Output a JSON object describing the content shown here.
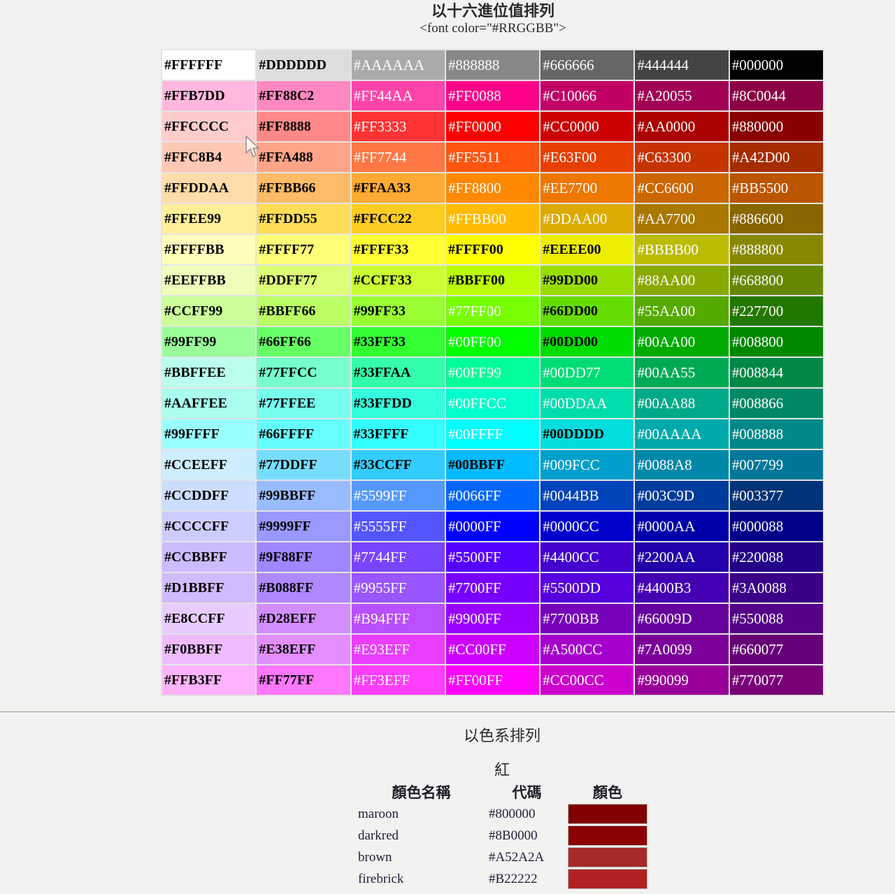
{
  "page": {
    "title": "以十六進位值排列",
    "subtitle": "<font color=\"#RRGGBB\">"
  },
  "colors": {
    "page_background": "#f2f2f0",
    "dark_text": "#000000",
    "light_text": "#FFFFFF"
  },
  "hex_table": {
    "rows": [
      [
        {
          "code": "#FFFFFF",
          "fg": "#000000"
        },
        {
          "code": "#DDDDDD",
          "fg": "#000000"
        },
        {
          "code": "#AAAAAA",
          "fg": "#FFFFFF"
        },
        {
          "code": "#888888",
          "fg": "#FFFFFF"
        },
        {
          "code": "#666666",
          "fg": "#FFFFFF"
        },
        {
          "code": "#444444",
          "fg": "#FFFFFF"
        },
        {
          "code": "#000000",
          "fg": "#FFFFFF"
        }
      ],
      [
        {
          "code": "#FFB7DD",
          "fg": "#000000"
        },
        {
          "code": "#FF88C2",
          "fg": "#000000"
        },
        {
          "code": "#FF44AA",
          "fg": "#FFFFFF"
        },
        {
          "code": "#FF0088",
          "fg": "#FFFFFF"
        },
        {
          "code": "#C10066",
          "fg": "#FFFFFF"
        },
        {
          "code": "#A20055",
          "fg": "#FFFFFF"
        },
        {
          "code": "#8C0044",
          "fg": "#FFFFFF"
        }
      ],
      [
        {
          "code": "#FFCCCC",
          "fg": "#000000"
        },
        {
          "code": "#FF8888",
          "fg": "#000000"
        },
        {
          "code": "#FF3333",
          "fg": "#FFFFFF"
        },
        {
          "code": "#FF0000",
          "fg": "#FFFFFF"
        },
        {
          "code": "#CC0000",
          "fg": "#FFFFFF"
        },
        {
          "code": "#AA0000",
          "fg": "#FFFFFF"
        },
        {
          "code": "#880000",
          "fg": "#FFFFFF"
        }
      ],
      [
        {
          "code": "#FFC8B4",
          "fg": "#000000"
        },
        {
          "code": "#FFA488",
          "fg": "#000000"
        },
        {
          "code": "#FF7744",
          "fg": "#FFFFFF"
        },
        {
          "code": "#FF5511",
          "fg": "#FFFFFF"
        },
        {
          "code": "#E63F00",
          "fg": "#FFFFFF"
        },
        {
          "code": "#C63300",
          "fg": "#FFFFFF"
        },
        {
          "code": "#A42D00",
          "fg": "#FFFFFF"
        }
      ],
      [
        {
          "code": "#FFDDAA",
          "fg": "#000000"
        },
        {
          "code": "#FFBB66",
          "fg": "#000000"
        },
        {
          "code": "#FFAA33",
          "fg": "#000000"
        },
        {
          "code": "#FF8800",
          "fg": "#FFFFFF"
        },
        {
          "code": "#EE7700",
          "fg": "#FFFFFF"
        },
        {
          "code": "#CC6600",
          "fg": "#FFFFFF"
        },
        {
          "code": "#BB5500",
          "fg": "#FFFFFF"
        }
      ],
      [
        {
          "code": "#FFEE99",
          "fg": "#000000"
        },
        {
          "code": "#FFDD55",
          "fg": "#000000"
        },
        {
          "code": "#FFCC22",
          "fg": "#000000"
        },
        {
          "code": "#FFBB00",
          "fg": "#FFFFFF"
        },
        {
          "code": "#DDAA00",
          "fg": "#FFFFFF"
        },
        {
          "code": "#AA7700",
          "fg": "#FFFFFF"
        },
        {
          "code": "#886600",
          "fg": "#FFFFFF"
        }
      ],
      [
        {
          "code": "#FFFFBB",
          "fg": "#000000"
        },
        {
          "code": "#FFFF77",
          "fg": "#000000"
        },
        {
          "code": "#FFFF33",
          "fg": "#000000"
        },
        {
          "code": "#FFFF00",
          "fg": "#000000"
        },
        {
          "code": "#EEEE00",
          "fg": "#000000"
        },
        {
          "code": "#BBBB00",
          "fg": "#FFFFFF"
        },
        {
          "code": "#888800",
          "fg": "#FFFFFF"
        }
      ],
      [
        {
          "code": "#EEFFBB",
          "fg": "#000000"
        },
        {
          "code": "#DDFF77",
          "fg": "#000000"
        },
        {
          "code": "#CCFF33",
          "fg": "#000000"
        },
        {
          "code": "#BBFF00",
          "fg": "#000000"
        },
        {
          "code": "#99DD00",
          "fg": "#000000"
        },
        {
          "code": "#88AA00",
          "fg": "#FFFFFF"
        },
        {
          "code": "#668800",
          "fg": "#FFFFFF"
        }
      ],
      [
        {
          "code": "#CCFF99",
          "fg": "#000000"
        },
        {
          "code": "#BBFF66",
          "fg": "#000000"
        },
        {
          "code": "#99FF33",
          "fg": "#000000"
        },
        {
          "code": "#77FF00",
          "fg": "#FFFFFF"
        },
        {
          "code": "#66DD00",
          "fg": "#000000"
        },
        {
          "code": "#55AA00",
          "fg": "#FFFFFF"
        },
        {
          "code": "#227700",
          "fg": "#FFFFFF"
        }
      ],
      [
        {
          "code": "#99FF99",
          "fg": "#000000"
        },
        {
          "code": "#66FF66",
          "fg": "#000000"
        },
        {
          "code": "#33FF33",
          "fg": "#000000"
        },
        {
          "code": "#00FF00",
          "fg": "#FFFFFF"
        },
        {
          "code": "#00DD00",
          "fg": "#000000"
        },
        {
          "code": "#00AA00",
          "fg": "#FFFFFF"
        },
        {
          "code": "#008800",
          "fg": "#FFFFFF"
        }
      ],
      [
        {
          "code": "#BBFFEE",
          "fg": "#000000"
        },
        {
          "code": "#77FFCC",
          "fg": "#000000"
        },
        {
          "code": "#33FFAA",
          "fg": "#000000"
        },
        {
          "code": "#00FF99",
          "fg": "#FFFFFF"
        },
        {
          "code": "#00DD77",
          "fg": "#FFFFFF"
        },
        {
          "code": "#00AA55",
          "fg": "#FFFFFF"
        },
        {
          "code": "#008844",
          "fg": "#FFFFFF"
        }
      ],
      [
        {
          "code": "#AAFFEE",
          "fg": "#000000"
        },
        {
          "code": "#77FFEE",
          "fg": "#000000"
        },
        {
          "code": "#33FFDD",
          "fg": "#000000"
        },
        {
          "code": "#00FFCC",
          "fg": "#FFFFFF"
        },
        {
          "code": "#00DDAA",
          "fg": "#FFFFFF"
        },
        {
          "code": "#00AA88",
          "fg": "#FFFFFF"
        },
        {
          "code": "#008866",
          "fg": "#FFFFFF"
        }
      ],
      [
        {
          "code": "#99FFFF",
          "fg": "#000000"
        },
        {
          "code": "#66FFFF",
          "fg": "#000000"
        },
        {
          "code": "#33FFFF",
          "fg": "#000000"
        },
        {
          "code": "#00FFFF",
          "fg": "#FFFFFF"
        },
        {
          "code": "#00DDDD",
          "fg": "#000000"
        },
        {
          "code": "#00AAAA",
          "fg": "#FFFFFF"
        },
        {
          "code": "#008888",
          "fg": "#FFFFFF"
        }
      ],
      [
        {
          "code": "#CCEEFF",
          "fg": "#000000"
        },
        {
          "code": "#77DDFF",
          "fg": "#000000"
        },
        {
          "code": "#33CCFF",
          "fg": "#000000"
        },
        {
          "code": "#00BBFF",
          "fg": "#000000"
        },
        {
          "code": "#009FCC",
          "fg": "#FFFFFF"
        },
        {
          "code": "#0088A8",
          "fg": "#FFFFFF"
        },
        {
          "code": "#007799",
          "fg": "#FFFFFF"
        }
      ],
      [
        {
          "code": "#CCDDFF",
          "fg": "#000000"
        },
        {
          "code": "#99BBFF",
          "fg": "#000000"
        },
        {
          "code": "#5599FF",
          "fg": "#FFFFFF"
        },
        {
          "code": "#0066FF",
          "fg": "#FFFFFF"
        },
        {
          "code": "#0044BB",
          "fg": "#FFFFFF"
        },
        {
          "code": "#003C9D",
          "fg": "#FFFFFF"
        },
        {
          "code": "#003377",
          "fg": "#FFFFFF"
        }
      ],
      [
        {
          "code": "#CCCCFF",
          "fg": "#000000"
        },
        {
          "code": "#9999FF",
          "fg": "#000000"
        },
        {
          "code": "#5555FF",
          "fg": "#FFFFFF"
        },
        {
          "code": "#0000FF",
          "fg": "#FFFFFF"
        },
        {
          "code": "#0000CC",
          "fg": "#FFFFFF"
        },
        {
          "code": "#0000AA",
          "fg": "#FFFFFF"
        },
        {
          "code": "#000088",
          "fg": "#FFFFFF"
        }
      ],
      [
        {
          "code": "#CCBBFF",
          "fg": "#000000"
        },
        {
          "code": "#9F88FF",
          "fg": "#000000"
        },
        {
          "code": "#7744FF",
          "fg": "#FFFFFF"
        },
        {
          "code": "#5500FF",
          "fg": "#FFFFFF"
        },
        {
          "code": "#4400CC",
          "fg": "#FFFFFF"
        },
        {
          "code": "#2200AA",
          "fg": "#FFFFFF"
        },
        {
          "code": "#220088",
          "fg": "#FFFFFF"
        }
      ],
      [
        {
          "code": "#D1BBFF",
          "fg": "#000000"
        },
        {
          "code": "#B088FF",
          "fg": "#000000"
        },
        {
          "code": "#9955FF",
          "fg": "#FFFFFF"
        },
        {
          "code": "#7700FF",
          "fg": "#FFFFFF"
        },
        {
          "code": "#5500DD",
          "fg": "#FFFFFF"
        },
        {
          "code": "#4400B3",
          "fg": "#FFFFFF"
        },
        {
          "code": "#3A0088",
          "fg": "#FFFFFF"
        }
      ],
      [
        {
          "code": "#E8CCFF",
          "fg": "#000000"
        },
        {
          "code": "#D28EFF",
          "fg": "#000000"
        },
        {
          "code": "#B94FFF",
          "fg": "#FFFFFF"
        },
        {
          "code": "#9900FF",
          "fg": "#FFFFFF"
        },
        {
          "code": "#7700BB",
          "fg": "#FFFFFF"
        },
        {
          "code": "#66009D",
          "fg": "#FFFFFF"
        },
        {
          "code": "#550088",
          "fg": "#FFFFFF"
        }
      ],
      [
        {
          "code": "#F0BBFF",
          "fg": "#000000"
        },
        {
          "code": "#E38EFF",
          "fg": "#000000"
        },
        {
          "code": "#E93EFF",
          "fg": "#FFFFFF"
        },
        {
          "code": "#CC00FF",
          "fg": "#FFFFFF"
        },
        {
          "code": "#A500CC",
          "fg": "#FFFFFF"
        },
        {
          "code": "#7A0099",
          "fg": "#FFFFFF"
        },
        {
          "code": "#660077",
          "fg": "#FFFFFF"
        }
      ],
      [
        {
          "code": "#FFB3FF",
          "fg": "#000000"
        },
        {
          "code": "#FF77FF",
          "fg": "#000000"
        },
        {
          "code": "#FF3EFF",
          "fg": "#FFFFFF"
        },
        {
          "code": "#FF00FF",
          "fg": "#FFFFFF"
        },
        {
          "code": "#CC00CC",
          "fg": "#FFFFFF"
        },
        {
          "code": "#990099",
          "fg": "#FFFFFF"
        },
        {
          "code": "#770077",
          "fg": "#FFFFFF"
        }
      ]
    ]
  },
  "family_section": {
    "title": "以色系排列",
    "group": "紅",
    "headers": {
      "name": "顏色名稱",
      "code": "代碼",
      "color": "顏色"
    },
    "rows": [
      {
        "name": "maroon",
        "code": "#800000"
      },
      {
        "name": "darkred",
        "code": "#8B0000"
      },
      {
        "name": "brown",
        "code": "#A52A2A"
      },
      {
        "name": "firebrick",
        "code": "#B22222"
      }
    ]
  },
  "icons": {
    "cursor": "mouse-cursor-icon"
  }
}
